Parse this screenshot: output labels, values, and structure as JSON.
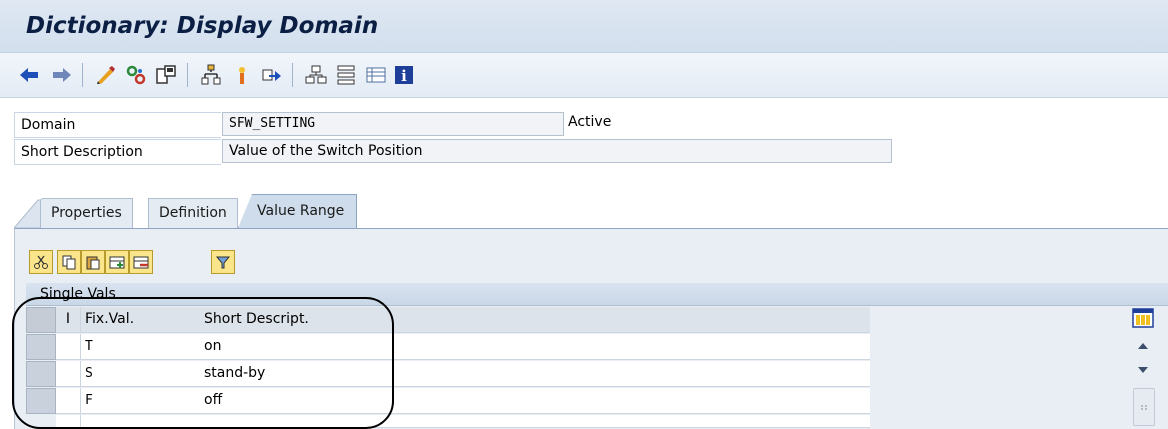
{
  "window": {
    "title": "Dictionary: Display Domain"
  },
  "toolbar": {
    "icons": [
      "back-icon",
      "forward-icon",
      "display-change-icon",
      "other-object-icon",
      "activate-icon",
      "where-used-icon",
      "object-list-icon",
      "navigation-icon",
      "hierarchy-icon",
      "tree-icon",
      "list-icon",
      "info-icon"
    ]
  },
  "header": {
    "domain_label": "Domain",
    "domain_value": "SFW_SETTING",
    "status": "Active",
    "shortdesc_label": "Short Description",
    "shortdesc_value": "Value of the Switch Position"
  },
  "tabs": [
    {
      "label": "Properties"
    },
    {
      "label": "Definition"
    },
    {
      "label": "Value Range",
      "active": true
    }
  ],
  "value_range": {
    "section_title": "Single Vals",
    "columns": {
      "i": "I",
      "fixval": "Fix.Val.",
      "shortdesc": "Short Descript."
    },
    "rows": [
      {
        "fixval": "T",
        "desc": "on"
      },
      {
        "fixval": "S",
        "desc": "stand-by"
      },
      {
        "fixval": "F",
        "desc": "off"
      }
    ]
  },
  "colors": {
    "title_bar": "#d2dfee",
    "accent_blue": "#0b1f45",
    "tab_active": "#cfdceb"
  }
}
